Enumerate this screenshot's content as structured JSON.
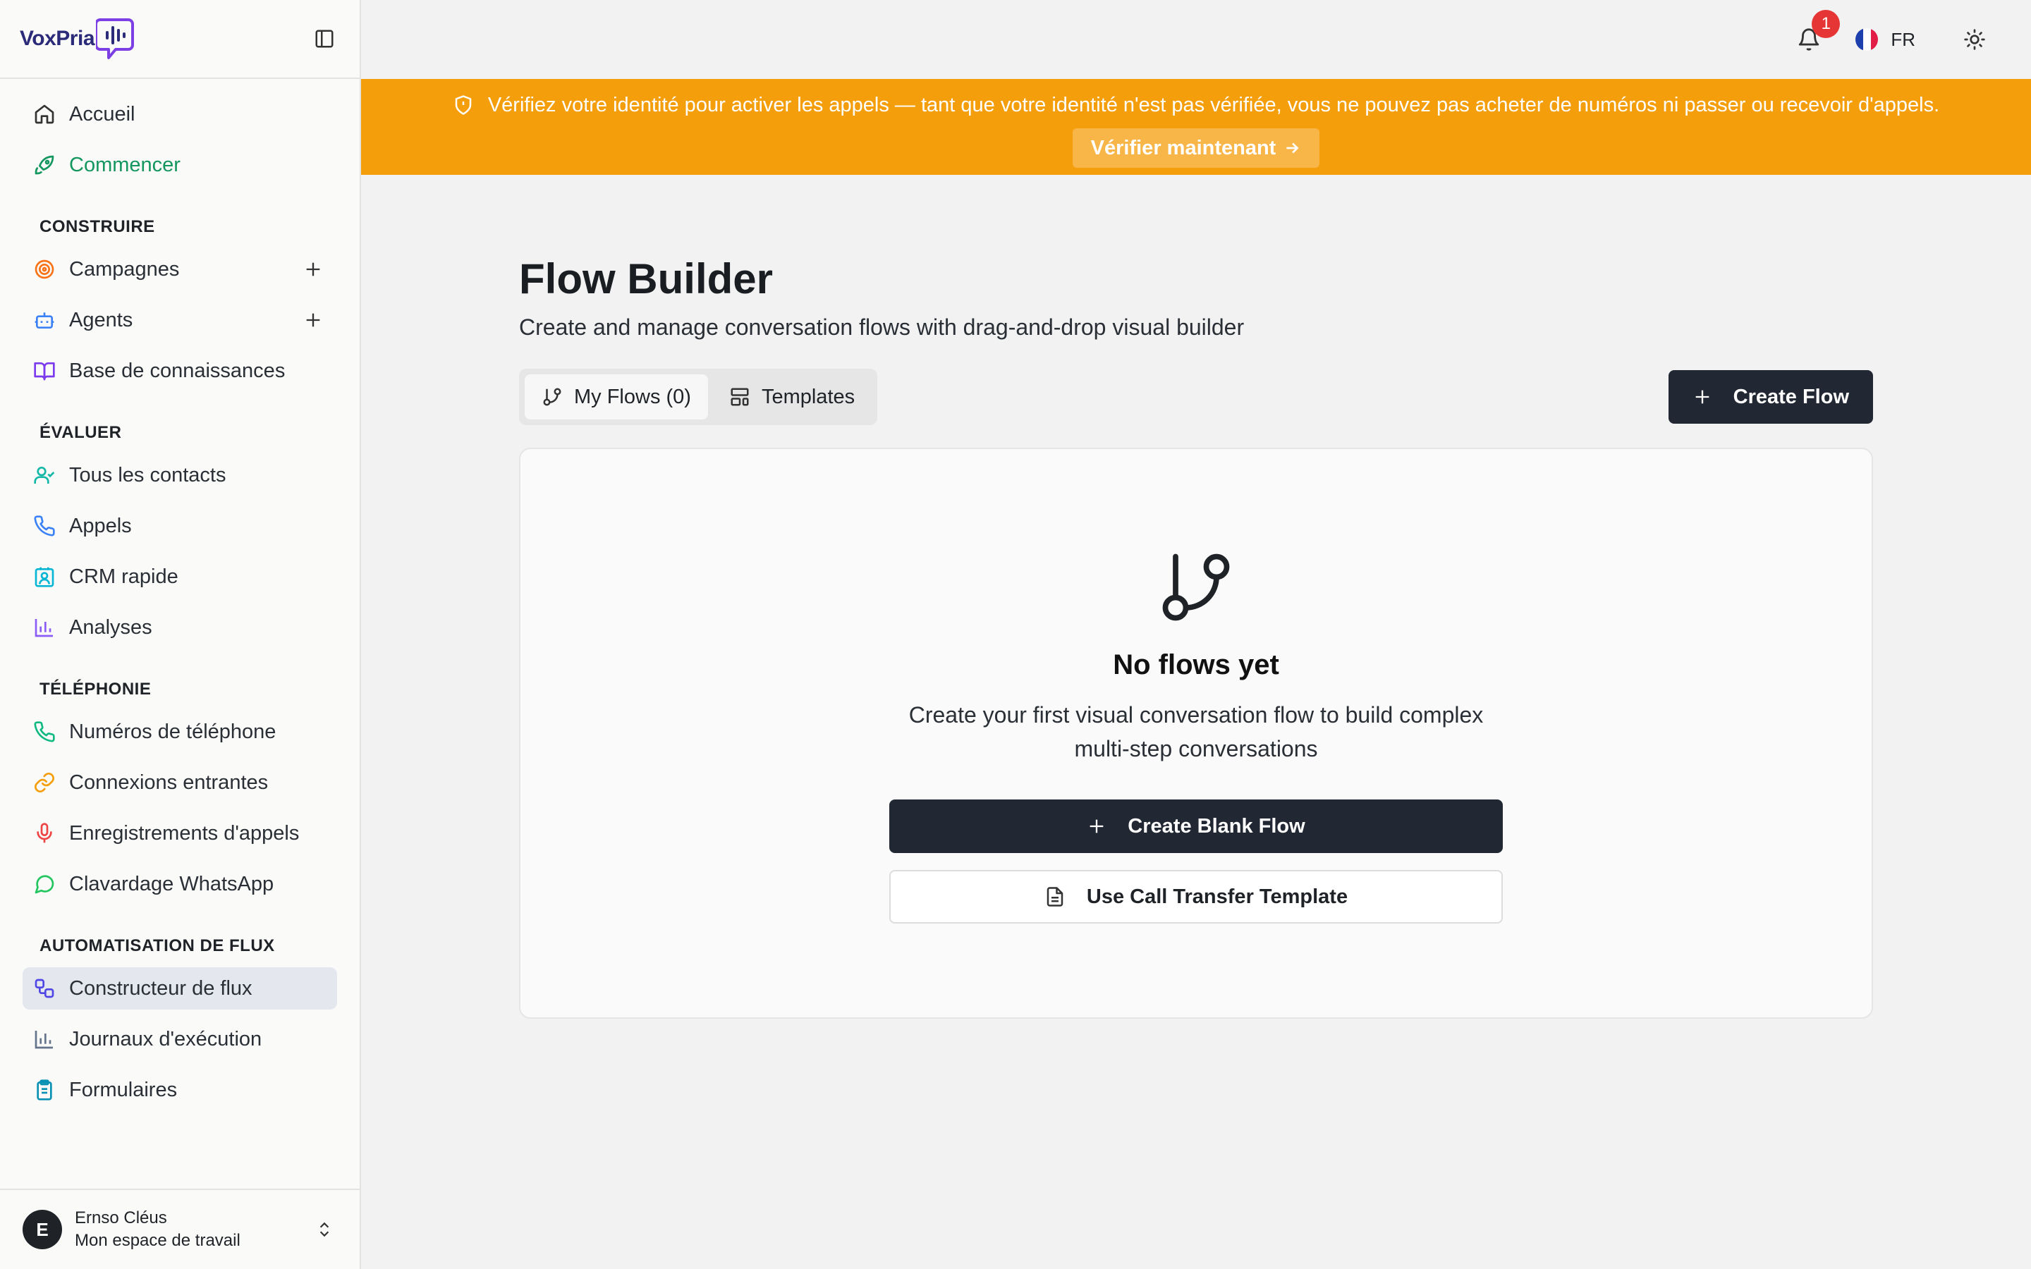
{
  "app": {
    "brand": "VoxPria"
  },
  "sidebar": {
    "top_items": [
      {
        "label": "Accueil",
        "icon": "home-icon"
      },
      {
        "label": "Commencer",
        "icon": "rocket-icon"
      }
    ],
    "sections": {
      "build": {
        "title": "CONSTRUIRE",
        "items": [
          {
            "label": "Campagnes",
            "icon": "target-icon"
          },
          {
            "label": "Agents",
            "icon": "bot-icon"
          },
          {
            "label": "Base de connaissances",
            "icon": "book-icon"
          }
        ]
      },
      "evaluate": {
        "title": "ÉVALUER",
        "items": [
          {
            "label": "Tous les contacts",
            "icon": "user-check-icon"
          },
          {
            "label": "Appels",
            "icon": "phone-icon"
          },
          {
            "label": "CRM rapide",
            "icon": "contact-card-icon"
          },
          {
            "label": "Analyses",
            "icon": "bar-chart-icon"
          }
        ]
      },
      "telephony": {
        "title": "TÉLÉPHONIE",
        "items": [
          {
            "label": "Numéros de téléphone",
            "icon": "phone-icon"
          },
          {
            "label": "Connexions entrantes",
            "icon": "link-icon"
          },
          {
            "label": "Enregistrements d'appels",
            "icon": "mic-icon"
          },
          {
            "label": "Clavardage WhatsApp",
            "icon": "message-circle-icon"
          }
        ]
      },
      "automation": {
        "title": "AUTOMATISATION DE FLUX",
        "items": [
          {
            "label": "Constructeur de flux",
            "icon": "workflow-icon"
          },
          {
            "label": "Journaux d'exécution",
            "icon": "bar-chart-icon"
          },
          {
            "label": "Formulaires",
            "icon": "clipboard-list-icon"
          }
        ]
      }
    },
    "user": {
      "initial": "E",
      "name": "Ernso Cléus",
      "workspace": "Mon espace de travail"
    }
  },
  "topbar": {
    "notification_count": "1",
    "language": "FR"
  },
  "banner": {
    "message": "Vérifiez votre identité pour activer les appels — tant que votre identité n'est pas vérifiée, vous ne pouvez pas acheter de numéros ni passer ou recevoir d'appels.",
    "action_label": "Vérifier maintenant"
  },
  "main": {
    "title": "Flow Builder",
    "subtitle": "Create and manage conversation flows with drag-and-drop visual builder",
    "tabs": [
      {
        "label": "My Flows (0)",
        "icon": "git-branch-icon"
      },
      {
        "label": "Templates",
        "icon": "layout-template-icon"
      }
    ],
    "create_label": "Create Flow",
    "empty": {
      "title": "No flows yet",
      "description": "Create your first visual conversation flow to build complex multi-step conversations",
      "blank_label": "Create Blank Flow",
      "template_label": "Use Call Transfer Template"
    }
  },
  "colors": {
    "banner": "#f59e0b",
    "primary_button": "#222833",
    "active_nav": "#14965f",
    "badge": "#e53535"
  }
}
